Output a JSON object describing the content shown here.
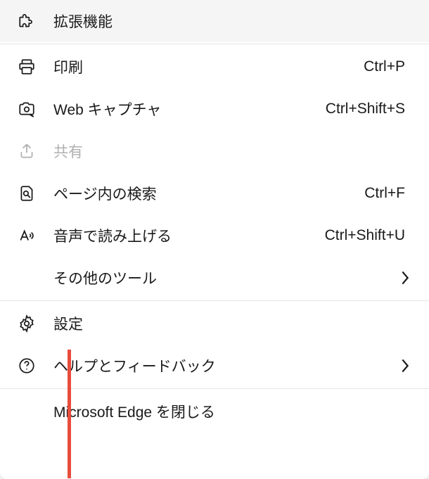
{
  "menu": {
    "items": [
      {
        "label": "拡張機能",
        "shortcut": "",
        "icon": "puzzle",
        "submenu": false,
        "disabled": false
      },
      {
        "label": "印刷",
        "shortcut": "Ctrl+P",
        "icon": "print",
        "submenu": false,
        "disabled": false
      },
      {
        "label": "Web キャプチャ",
        "shortcut": "Ctrl+Shift+S",
        "icon": "camera",
        "submenu": false,
        "disabled": false
      },
      {
        "label": "共有",
        "shortcut": "",
        "icon": "share",
        "submenu": false,
        "disabled": true
      },
      {
        "label": "ページ内の検索",
        "shortcut": "Ctrl+F",
        "icon": "find",
        "submenu": false,
        "disabled": false
      },
      {
        "label": "音声で読み上げる",
        "shortcut": "Ctrl+Shift+U",
        "icon": "read-aloud",
        "submenu": false,
        "disabled": false
      },
      {
        "label": "その他のツール",
        "shortcut": "",
        "icon": "",
        "submenu": true,
        "disabled": false
      },
      {
        "label": "設定",
        "shortcut": "",
        "icon": "settings",
        "submenu": false,
        "disabled": false
      },
      {
        "label": "ヘルプとフィードバック",
        "shortcut": "",
        "icon": "help",
        "submenu": true,
        "disabled": false
      },
      {
        "label": "Microsoft Edge を閉じる",
        "shortcut": "",
        "icon": "",
        "submenu": false,
        "disabled": false
      }
    ]
  }
}
